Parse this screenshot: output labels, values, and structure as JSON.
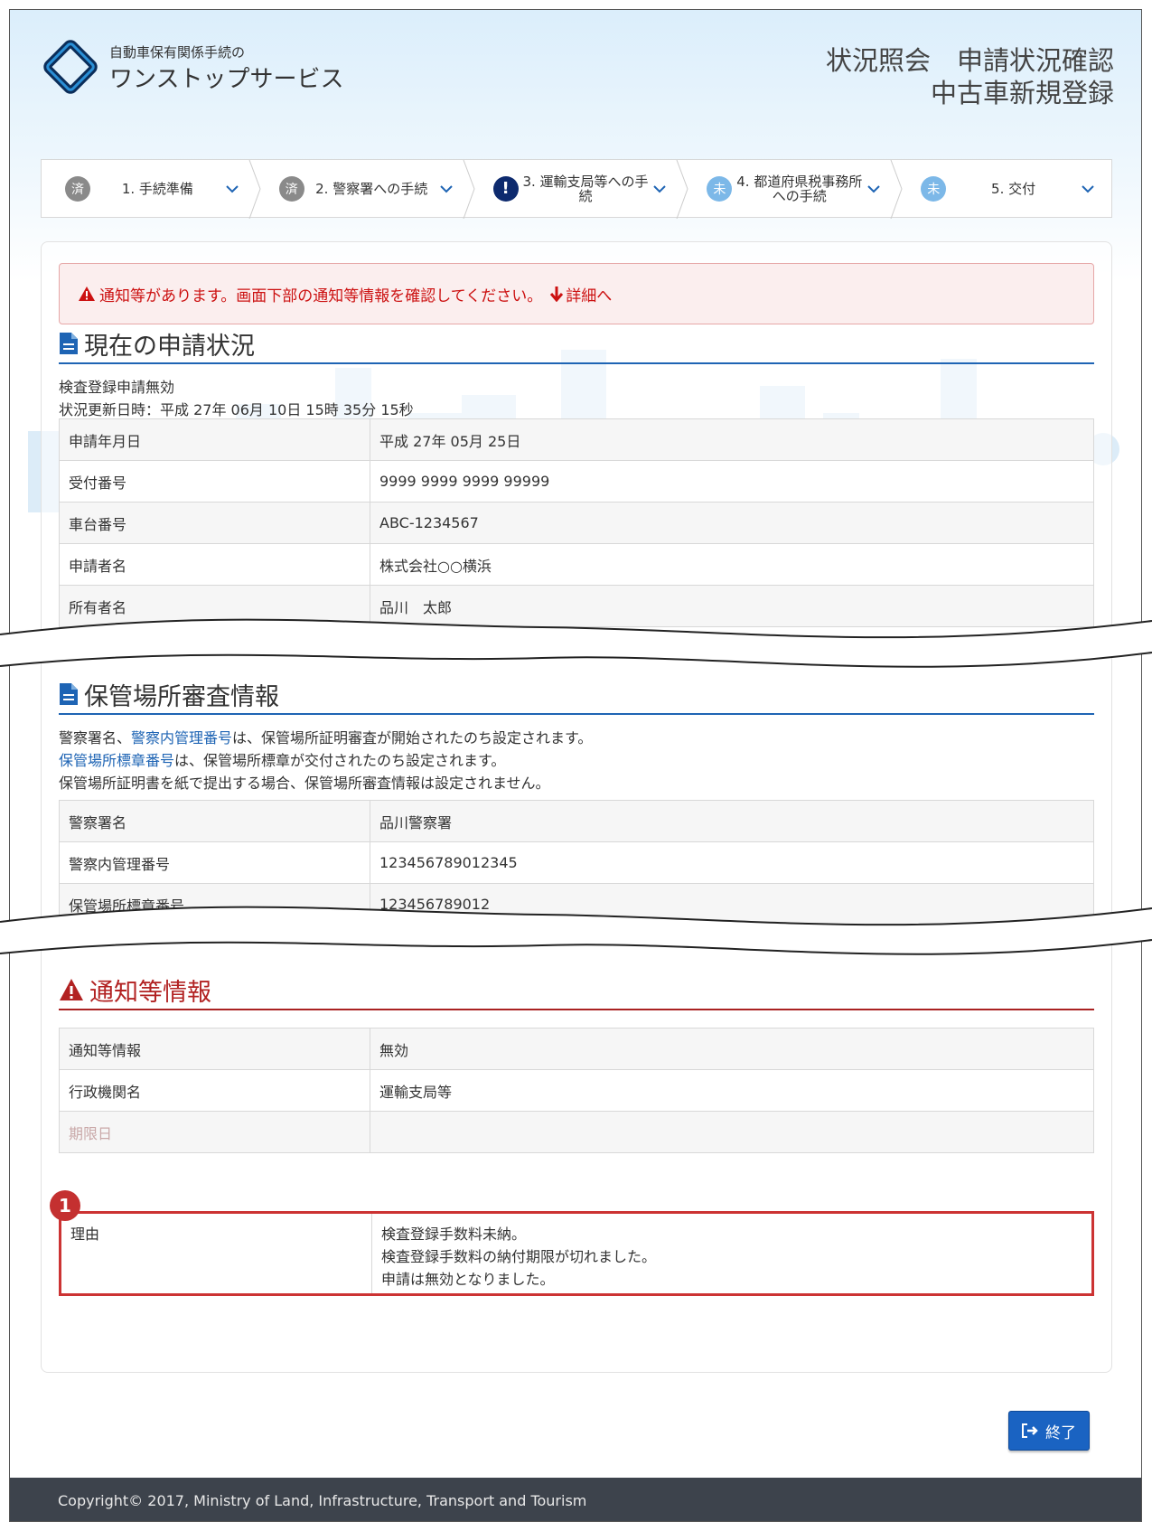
{
  "header": {
    "brand_small": "自動車保有関係手続の",
    "brand_large": "ワンストップサービス",
    "title_line1": "状況照会　申請状況確認",
    "title_line2": "中古車新規登録"
  },
  "steps": [
    {
      "badge": "済",
      "label": "1. 手続準備",
      "status": "done"
    },
    {
      "badge": "済",
      "label": "2. 警察署への手続",
      "status": "done"
    },
    {
      "badge": "!",
      "label": "3. 運輸支局等への手続",
      "status": "warn"
    },
    {
      "badge": "未",
      "label": "4. 都道府県税事務所への手続",
      "status": "todo"
    },
    {
      "badge": "未",
      "label": "5. 交付",
      "status": "todo"
    }
  ],
  "alert": {
    "message": "通知等があります。画面下部の通知等情報を確認してください。",
    "link": "詳細へ"
  },
  "status_section": {
    "title": "現在の申請状況",
    "status_text": "検査登録申請無効",
    "updated": "状況更新日時：平成 27年 06月 10日 15時 35分 15秒",
    "rows": [
      {
        "key": "申請年月日",
        "value": "平成 27年 05月 25日"
      },
      {
        "key": "受付番号",
        "value": "9999 9999 9999 99999"
      },
      {
        "key": "車台番号",
        "value": "ABC-1234567"
      },
      {
        "key": "申請者名",
        "value": "株式会社○○横浜"
      },
      {
        "key": "所有者名",
        "value": "品川　太郎"
      }
    ]
  },
  "parking_section": {
    "title": "保管場所審査情報",
    "note1_link": "警察内管理番号",
    "note1_a": "警察署名、",
    "note1_b": "は、保管場所証明審査が開始されたのち設定されます。",
    "note2_link": "保管場所標章番号",
    "note2_b": "は、保管場所標章が交付されたのち設定されます。",
    "note3": "保管場所証明書を紙で提出する場合、保管場所審査情報は設定されません。",
    "rows": [
      {
        "key": "警察署名",
        "value": "品川警察署"
      },
      {
        "key": "警察内管理番号",
        "value": "123456789012345"
      },
      {
        "key": "保管場所標章番号",
        "value": "123456789012"
      }
    ]
  },
  "notice_section": {
    "title": "通知等情報",
    "rows": [
      {
        "key": "通知等情報",
        "value": "無効"
      },
      {
        "key": "行政機関名",
        "value": "運輸支局等"
      },
      {
        "key": "期限日",
        "value": ""
      }
    ],
    "reason_key": "理由",
    "reason_lines": [
      "検査登録手数料未納。",
      "検査登録手数料の納付期限が切れました。",
      "申請は無効となりました。"
    ],
    "marker": "1"
  },
  "end_button": {
    "label": "終了"
  },
  "footer": {
    "copyright": "Copyright© 2017, Ministry of Land, Infrastructure, Transport and Tourism"
  },
  "colors": {
    "accent": "#1e64b4",
    "alert": "#cc1111",
    "footer": "#3d434c"
  }
}
